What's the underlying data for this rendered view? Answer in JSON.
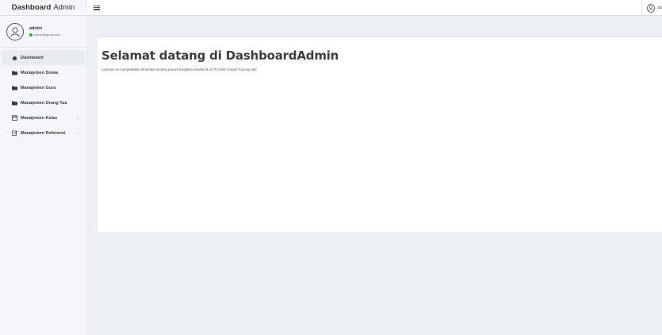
{
  "brand": {
    "bold": "Dashboard",
    "light": "Admin"
  },
  "user": {
    "name": "admin",
    "email": "admin@gmail.com"
  },
  "topbar": {
    "user_label": "adm"
  },
  "nav": {
    "items": [
      {
        "label": "Dashboard",
        "icon": "home-icon",
        "active": true
      },
      {
        "label": "Manajemen Siswa",
        "icon": "folder-icon"
      },
      {
        "label": "Manajemen Guru",
        "icon": "folder-icon"
      },
      {
        "label": "Manajemen Orang Tua",
        "icon": "folder-icon"
      },
      {
        "label": "Manajemen Kelas",
        "icon": "calendar-icon",
        "chevron": "‹"
      },
      {
        "label": "Manajemen Referensi",
        "icon": "edit-icon",
        "chevron": "‹"
      }
    ]
  },
  "main": {
    "welcome_prefix": "Selamat datang di ",
    "welcome_bold": "DashboardAdmin",
    "lead": "Layanan ini menyediakan informasi tentang proses Kegiatan Akademik di TK Islam Sunan Gunung Jati"
  }
}
